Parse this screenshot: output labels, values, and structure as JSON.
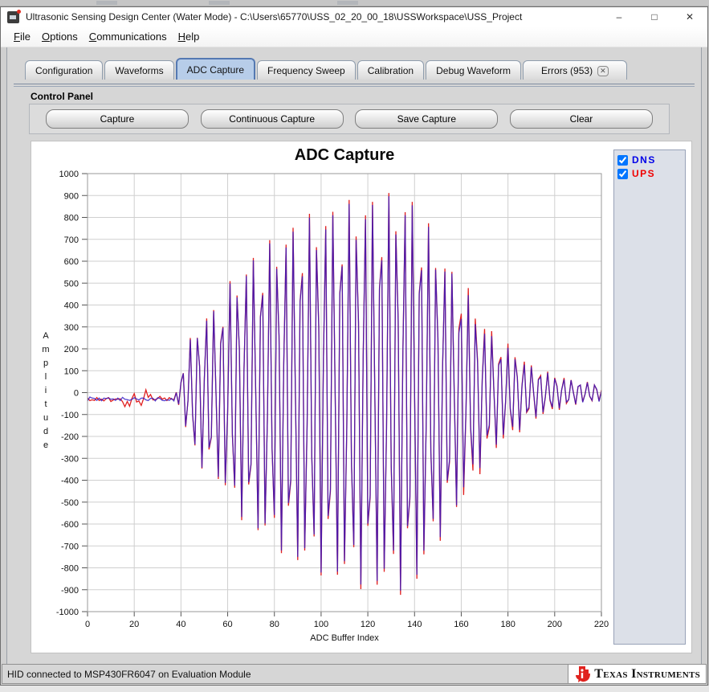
{
  "window": {
    "title": "Ultrasonic Sensing Design Center (Water Mode) - C:\\Users\\65770\\USS_02_20_00_18\\USSWorkspace\\USS_Project",
    "controls": {
      "minimize": "–",
      "maximize": "□",
      "close": "✕"
    }
  },
  "menu": {
    "items": [
      "File",
      "Options",
      "Communications",
      "Help"
    ]
  },
  "tabs": [
    {
      "label": "Configuration"
    },
    {
      "label": "Waveforms"
    },
    {
      "label": "ADC Capture"
    },
    {
      "label": "Frequency Sweep"
    },
    {
      "label": "Calibration"
    },
    {
      "label": "Debug Waveform"
    },
    {
      "label": "Errors (953)",
      "closable": true
    }
  ],
  "active_tab": "ADC Capture",
  "control_panel": {
    "label": "Control Panel",
    "buttons": [
      "Capture",
      "Continuous Capture",
      "Save Capture",
      "Clear"
    ]
  },
  "chart_data": {
    "type": "line",
    "title": "ADC Capture",
    "xlabel": "ADC Buffer Index",
    "ylabel": "Amplitude",
    "xlim": [
      0,
      220
    ],
    "ylim": [
      -1000,
      1000
    ],
    "x_tick_step": 20,
    "y_tick_step": 100,
    "grid": true,
    "legend_position": "right",
    "series": [
      {
        "name": "DNS",
        "color": "#2f18c4",
        "checked": true
      },
      {
        "name": "UPS",
        "color": "#e02020",
        "checked": true
      }
    ],
    "waveform": {
      "kind": "ultrasonic_burst",
      "note": "DNS and UPS traces overlap almost exactly; red UPS peaks show slightly past blue DNS in the decay region",
      "baseline": -30,
      "noise_amplitude": 20,
      "red_noise_burst_region": [
        16,
        28
      ],
      "quiet_region": [
        0,
        38
      ],
      "burst_region": [
        38,
        220
      ],
      "period_samples": 3.4,
      "envelope_keypoints": [
        [
          38,
          20
        ],
        [
          40,
          90
        ],
        [
          42,
          170
        ],
        [
          45,
          280
        ],
        [
          50,
          360
        ],
        [
          56,
          400
        ],
        [
          62,
          520
        ],
        [
          70,
          620
        ],
        [
          80,
          700
        ],
        [
          90,
          780
        ],
        [
          100,
          825
        ],
        [
          110,
          860
        ],
        [
          120,
          888
        ],
        [
          127,
          898
        ],
        [
          134,
          908
        ],
        [
          138,
          902
        ],
        [
          142,
          852
        ],
        [
          146,
          760
        ],
        [
          150,
          685
        ],
        [
          154,
          595
        ],
        [
          158,
          535
        ],
        [
          162,
          465
        ],
        [
          166,
          392
        ],
        [
          170,
          300
        ],
        [
          174,
          258
        ],
        [
          178,
          215
        ],
        [
          184,
          186
        ],
        [
          188,
          128
        ],
        [
          192,
          115
        ],
        [
          196,
          95
        ],
        [
          202,
          72
        ],
        [
          208,
          56
        ],
        [
          214,
          46
        ],
        [
          220,
          40
        ]
      ]
    }
  },
  "status_bar": {
    "text": "HID connected to MSP430FR6047 on Evaluation Module",
    "brand": "Texas Instruments"
  }
}
